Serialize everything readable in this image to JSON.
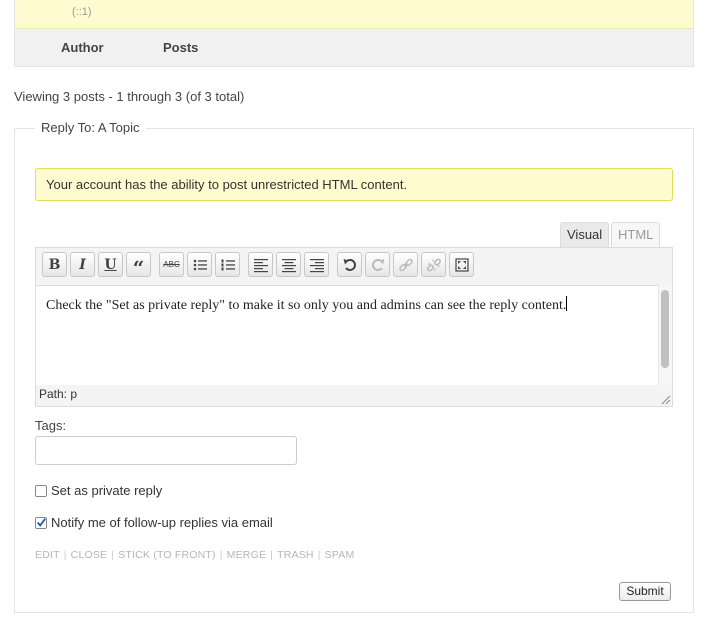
{
  "topic_meta": {
    "ip_text": "(::1)"
  },
  "table_header": {
    "author": "Author",
    "posts": "Posts"
  },
  "pagination": {
    "viewing_text": "Viewing 3 posts - 1 through 3 (of 3 total)"
  },
  "reply_form": {
    "legend": "Reply To: A Topic",
    "notice": "Your account has the ability to post unrestricted HTML content.",
    "tabs": {
      "visual": "Visual",
      "html": "HTML"
    },
    "active_tab": "Visual",
    "toolbar": [
      {
        "name": "bold-button",
        "glyph": "B",
        "icon": "bold-icon"
      },
      {
        "name": "italic-button",
        "glyph": "I",
        "icon": "italic-icon"
      },
      {
        "name": "underline-button",
        "glyph": "U",
        "icon": "underline-icon"
      },
      {
        "name": "blockquote-button",
        "glyph": "“",
        "icon": "blockquote-icon"
      },
      {
        "name": "strikethrough-button",
        "glyph": "ABC",
        "icon": "strikethrough-icon"
      },
      {
        "name": "bullet-list-button",
        "icon": "bullet-list-icon"
      },
      {
        "name": "numbered-list-button",
        "icon": "numbered-list-icon"
      },
      {
        "name": "align-left-button",
        "icon": "align-left-icon"
      },
      {
        "name": "align-center-button",
        "icon": "align-center-icon"
      },
      {
        "name": "align-right-button",
        "icon": "align-right-icon"
      },
      {
        "name": "undo-button",
        "icon": "undo-icon"
      },
      {
        "name": "redo-button",
        "icon": "redo-icon",
        "disabled": true
      },
      {
        "name": "insert-link-button",
        "icon": "link-icon",
        "disabled": true
      },
      {
        "name": "unlink-button",
        "icon": "unlink-icon",
        "disabled": true
      },
      {
        "name": "fullscreen-button",
        "icon": "fullscreen-icon"
      }
    ],
    "content": "Check the \"Set as private reply\" to make it so only you and admins can see the reply content.",
    "path_label": "Path:",
    "path_value": "p",
    "tags_label": "Tags:",
    "tags_value": "",
    "private_reply": {
      "label": "Set as private reply",
      "checked": false
    },
    "notify": {
      "label": "Notify me of follow-up replies via email",
      "checked": true
    },
    "admin_links": [
      "EDIT",
      "CLOSE",
      "STICK (TO FRONT)",
      "MERGE",
      "TRASH",
      "SPAM"
    ],
    "submit_label": "Submit"
  },
  "colors": {
    "notice_bg": "#fdfbcf",
    "notice_border": "#e6db55",
    "check_accent": "#1c5da8"
  }
}
